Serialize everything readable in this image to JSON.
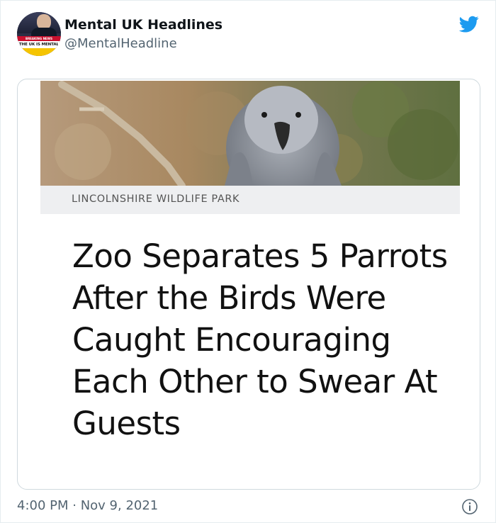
{
  "tweet": {
    "author": {
      "name": "Mental UK Headlines",
      "handle": "@MentalHeadline",
      "avatar_text": "THE UK IS MENTAL",
      "avatar_banner": "BREAKING NEWS"
    },
    "timestamp": "4:00 PM · Nov 9, 2021",
    "icons": {
      "platform": "twitter-bird-icon",
      "info": "info-icon"
    },
    "accent_color": "#1d9bf0"
  },
  "article": {
    "photo_subject": "grey parrot on branch",
    "caption": "LINCOLNSHIRE WILDLIFE PARK",
    "headline": "Zoo Separates 5 Parrots After the Birds Were Caught Encouraging Each Other to Swear At Guests"
  }
}
